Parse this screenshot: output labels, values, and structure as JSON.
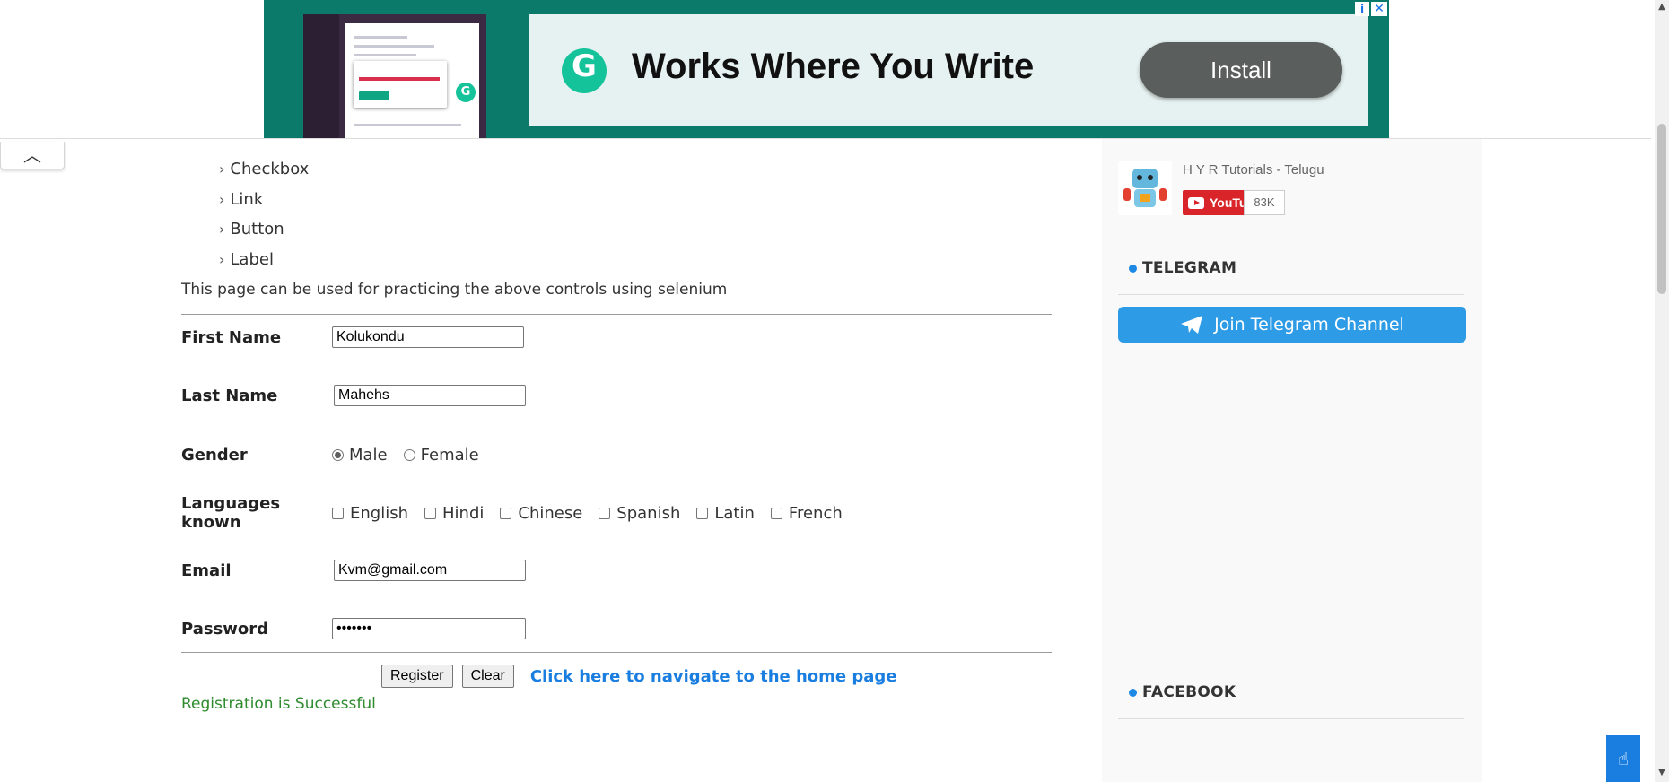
{
  "ad": {
    "headline": "Works Where You Write",
    "install_label": "Install",
    "logo_letter": "G",
    "info_glyph": "i",
    "close_glyph": "✕"
  },
  "collapse_glyph": "︿",
  "controls_list": {
    "chevron": "›",
    "items": [
      "Checkbox",
      "Link",
      "Button",
      "Label"
    ]
  },
  "intro_text": "This page can be used for practicing the above controls using selenium",
  "form": {
    "first_name": {
      "label": "First Name",
      "value": "Kolukondu"
    },
    "last_name": {
      "label": "Last Name",
      "value": "Mahehs"
    },
    "gender": {
      "label": "Gender",
      "options": [
        "Male",
        "Female"
      ],
      "selected": "Male"
    },
    "languages": {
      "label": "Languages known",
      "options": [
        "English",
        "Hindi",
        "Chinese",
        "Spanish",
        "Latin",
        "French"
      ]
    },
    "email": {
      "label": "Email",
      "value": "Kvm@gmail.com"
    },
    "password": {
      "label": "Password",
      "value": "•••••••"
    },
    "register_label": "Register",
    "clear_label": "Clear",
    "home_link": "Click here to navigate to the home page",
    "success_message": "Registration is Successful"
  },
  "sidebar": {
    "youtube": {
      "channel": "H Y R Tutorials - Telugu",
      "button": "YouTube",
      "subscribers": "83K"
    },
    "telegram": {
      "title": "TELEGRAM",
      "button": "Join Telegram Channel"
    },
    "facebook": {
      "title": "FACEBOOK"
    }
  },
  "colors": {
    "accent": "#1a7ee0",
    "success": "#2e8b2e",
    "telegram": "#2e9be6",
    "youtube": "#d9252a",
    "ad_bg": "#0b7a6b"
  },
  "icons": {
    "fab": "hand-pointer-icon",
    "telegram": "paper-plane-icon"
  }
}
